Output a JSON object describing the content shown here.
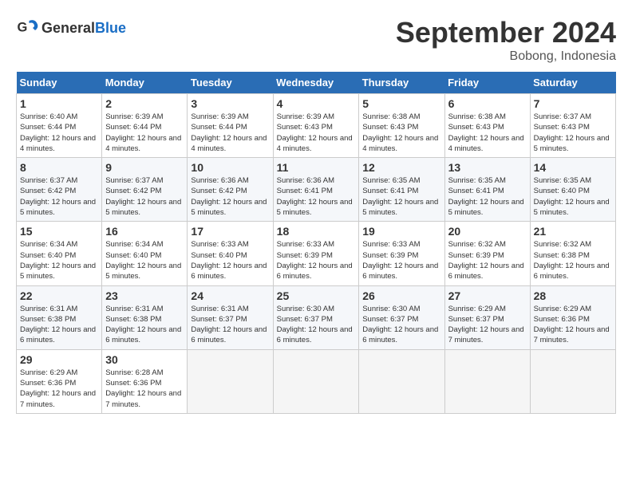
{
  "header": {
    "logo_general": "General",
    "logo_blue": "Blue",
    "month_title": "September 2024",
    "location": "Bobong, Indonesia"
  },
  "columns": [
    "Sunday",
    "Monday",
    "Tuesday",
    "Wednesday",
    "Thursday",
    "Friday",
    "Saturday"
  ],
  "weeks": [
    [
      {
        "day": "1",
        "sunrise": "6:40 AM",
        "sunset": "6:44 PM",
        "daylight": "12 hours and 4 minutes."
      },
      {
        "day": "2",
        "sunrise": "6:39 AM",
        "sunset": "6:44 PM",
        "daylight": "12 hours and 4 minutes."
      },
      {
        "day": "3",
        "sunrise": "6:39 AM",
        "sunset": "6:44 PM",
        "daylight": "12 hours and 4 minutes."
      },
      {
        "day": "4",
        "sunrise": "6:39 AM",
        "sunset": "6:43 PM",
        "daylight": "12 hours and 4 minutes."
      },
      {
        "day": "5",
        "sunrise": "6:38 AM",
        "sunset": "6:43 PM",
        "daylight": "12 hours and 4 minutes."
      },
      {
        "day": "6",
        "sunrise": "6:38 AM",
        "sunset": "6:43 PM",
        "daylight": "12 hours and 4 minutes."
      },
      {
        "day": "7",
        "sunrise": "6:37 AM",
        "sunset": "6:43 PM",
        "daylight": "12 hours and 5 minutes."
      }
    ],
    [
      {
        "day": "8",
        "sunrise": "6:37 AM",
        "sunset": "6:42 PM",
        "daylight": "12 hours and 5 minutes."
      },
      {
        "day": "9",
        "sunrise": "6:37 AM",
        "sunset": "6:42 PM",
        "daylight": "12 hours and 5 minutes."
      },
      {
        "day": "10",
        "sunrise": "6:36 AM",
        "sunset": "6:42 PM",
        "daylight": "12 hours and 5 minutes."
      },
      {
        "day": "11",
        "sunrise": "6:36 AM",
        "sunset": "6:41 PM",
        "daylight": "12 hours and 5 minutes."
      },
      {
        "day": "12",
        "sunrise": "6:35 AM",
        "sunset": "6:41 PM",
        "daylight": "12 hours and 5 minutes."
      },
      {
        "day": "13",
        "sunrise": "6:35 AM",
        "sunset": "6:41 PM",
        "daylight": "12 hours and 5 minutes."
      },
      {
        "day": "14",
        "sunrise": "6:35 AM",
        "sunset": "6:40 PM",
        "daylight": "12 hours and 5 minutes."
      }
    ],
    [
      {
        "day": "15",
        "sunrise": "6:34 AM",
        "sunset": "6:40 PM",
        "daylight": "12 hours and 5 minutes."
      },
      {
        "day": "16",
        "sunrise": "6:34 AM",
        "sunset": "6:40 PM",
        "daylight": "12 hours and 5 minutes."
      },
      {
        "day": "17",
        "sunrise": "6:33 AM",
        "sunset": "6:40 PM",
        "daylight": "12 hours and 6 minutes."
      },
      {
        "day": "18",
        "sunrise": "6:33 AM",
        "sunset": "6:39 PM",
        "daylight": "12 hours and 6 minutes."
      },
      {
        "day": "19",
        "sunrise": "6:33 AM",
        "sunset": "6:39 PM",
        "daylight": "12 hours and 6 minutes."
      },
      {
        "day": "20",
        "sunrise": "6:32 AM",
        "sunset": "6:39 PM",
        "daylight": "12 hours and 6 minutes."
      },
      {
        "day": "21",
        "sunrise": "6:32 AM",
        "sunset": "6:38 PM",
        "daylight": "12 hours and 6 minutes."
      }
    ],
    [
      {
        "day": "22",
        "sunrise": "6:31 AM",
        "sunset": "6:38 PM",
        "daylight": "12 hours and 6 minutes."
      },
      {
        "day": "23",
        "sunrise": "6:31 AM",
        "sunset": "6:38 PM",
        "daylight": "12 hours and 6 minutes."
      },
      {
        "day": "24",
        "sunrise": "6:31 AM",
        "sunset": "6:37 PM",
        "daylight": "12 hours and 6 minutes."
      },
      {
        "day": "25",
        "sunrise": "6:30 AM",
        "sunset": "6:37 PM",
        "daylight": "12 hours and 6 minutes."
      },
      {
        "day": "26",
        "sunrise": "6:30 AM",
        "sunset": "6:37 PM",
        "daylight": "12 hours and 6 minutes."
      },
      {
        "day": "27",
        "sunrise": "6:29 AM",
        "sunset": "6:37 PM",
        "daylight": "12 hours and 7 minutes."
      },
      {
        "day": "28",
        "sunrise": "6:29 AM",
        "sunset": "6:36 PM",
        "daylight": "12 hours and 7 minutes."
      }
    ],
    [
      {
        "day": "29",
        "sunrise": "6:29 AM",
        "sunset": "6:36 PM",
        "daylight": "12 hours and 7 minutes."
      },
      {
        "day": "30",
        "sunrise": "6:28 AM",
        "sunset": "6:36 PM",
        "daylight": "12 hours and 7 minutes."
      },
      null,
      null,
      null,
      null,
      null
    ]
  ]
}
